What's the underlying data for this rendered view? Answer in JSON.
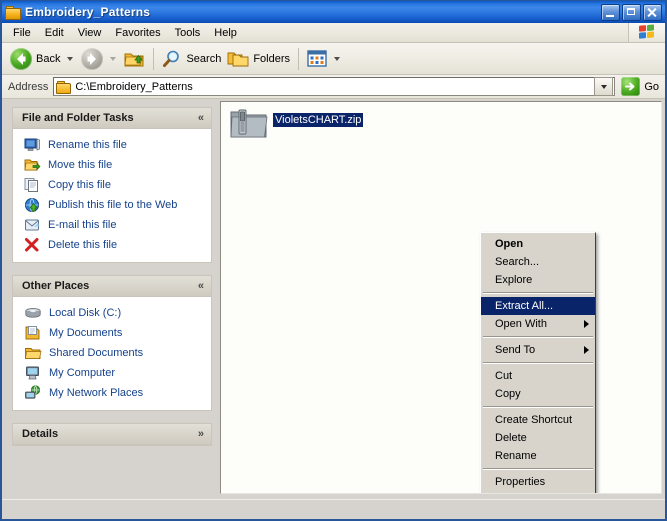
{
  "window": {
    "title": "Embroidery_Patterns",
    "title_icon": "folder-icon",
    "buttons": {
      "minimize": "minimize-button",
      "maximize": "maximize-button",
      "close": "close-button"
    }
  },
  "menubar": {
    "items": [
      "File",
      "Edit",
      "View",
      "Favorites",
      "Tools",
      "Help"
    ],
    "logo": "windows-flag-logo"
  },
  "toolbar": {
    "back_label": "Back",
    "forward_label": "",
    "up_label": "",
    "search_label": "Search",
    "folders_label": "Folders",
    "views_label": ""
  },
  "address": {
    "label": "Address",
    "value": "C:\\Embroidery_Patterns",
    "placeholder": "C:\\Embroidery_Patterns",
    "go_label": "Go"
  },
  "sidebar": {
    "panels": [
      {
        "title": "File and Folder Tasks",
        "collapsed": false,
        "chevron": "«",
        "items": [
          {
            "label": "Rename this file",
            "icon": "rename-icon"
          },
          {
            "label": "Move this file",
            "icon": "move-icon"
          },
          {
            "label": "Copy this file",
            "icon": "copy-icon"
          },
          {
            "label": "Publish this file to the Web",
            "icon": "publish-web-icon"
          },
          {
            "label": "E-mail this file",
            "icon": "email-icon"
          },
          {
            "label": "Delete this file",
            "icon": "delete-x-icon"
          }
        ]
      },
      {
        "title": "Other Places",
        "collapsed": false,
        "chevron": "«",
        "items": [
          {
            "label": "Local Disk (C:)",
            "icon": "hard-disk-icon"
          },
          {
            "label": "My Documents",
            "icon": "my-documents-icon"
          },
          {
            "label": "Shared Documents",
            "icon": "shared-documents-icon"
          },
          {
            "label": "My Computer",
            "icon": "my-computer-icon"
          },
          {
            "label": "My Network Places",
            "icon": "network-places-icon"
          }
        ]
      },
      {
        "title": "Details",
        "collapsed": true,
        "chevron": "»",
        "items": []
      }
    ]
  },
  "files": [
    {
      "name": "VioletsCHART.zip",
      "icon": "zip-folder-icon",
      "selected": true
    }
  ],
  "context_menu": {
    "items": [
      {
        "label": "Open",
        "bold": true,
        "selected": false,
        "submenu": false
      },
      {
        "label": "Search...",
        "bold": false,
        "selected": false,
        "submenu": false
      },
      {
        "label": "Explore",
        "bold": false,
        "selected": false,
        "submenu": false
      },
      {
        "separator": true
      },
      {
        "label": "Extract All...",
        "bold": false,
        "selected": true,
        "submenu": false
      },
      {
        "label": "Open With",
        "bold": false,
        "selected": false,
        "submenu": true
      },
      {
        "separator": true
      },
      {
        "label": "Send To",
        "bold": false,
        "selected": false,
        "submenu": true
      },
      {
        "separator": true
      },
      {
        "label": "Cut",
        "bold": false,
        "selected": false,
        "submenu": false
      },
      {
        "label": "Copy",
        "bold": false,
        "selected": false,
        "submenu": false
      },
      {
        "separator": true
      },
      {
        "label": "Create Shortcut",
        "bold": false,
        "selected": false,
        "submenu": false
      },
      {
        "label": "Delete",
        "bold": false,
        "selected": false,
        "submenu": false
      },
      {
        "label": "Rename",
        "bold": false,
        "selected": false,
        "submenu": false
      },
      {
        "separator": true
      },
      {
        "label": "Properties",
        "bold": false,
        "selected": false,
        "submenu": false
      }
    ]
  },
  "statusbar": {
    "text": ""
  },
  "colors": {
    "title_blue": "#1b62d0",
    "selection_navy": "#0a246a",
    "sidebar_bg": "#d6d3ce",
    "link_blue": "#15428b",
    "accent_green": "#49a821"
  }
}
